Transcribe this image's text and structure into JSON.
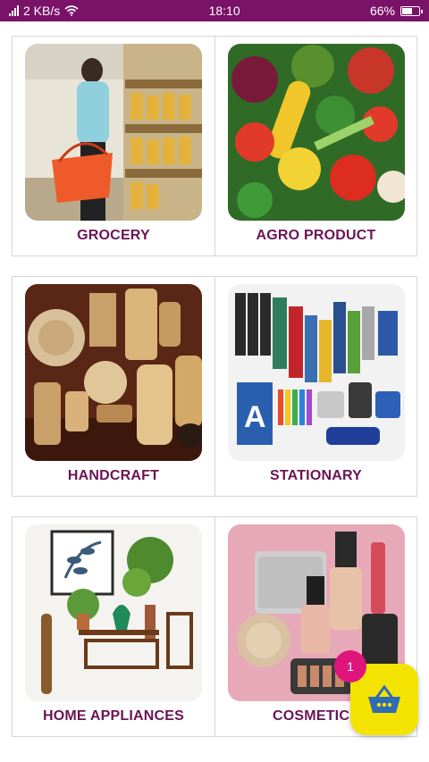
{
  "status_bar": {
    "network_speed": "2 KB/s",
    "time": "18:10",
    "battery_percent": "66%",
    "battery_level": 0.66
  },
  "categories": [
    {
      "label": "GROCERY"
    },
    {
      "label": "AGRO PRODUCT"
    },
    {
      "label": "HANDCRAFT"
    },
    {
      "label": "STATIONARY"
    },
    {
      "label": "HOME APPLIANCES"
    },
    {
      "label": "COSMETICS"
    }
  ],
  "cart": {
    "count": "1",
    "icon": "basket-icon",
    "accent": "#f4e300",
    "badge_color": "#e0157b"
  },
  "colors": {
    "status_bar": "#7a1268",
    "label": "#6a1457"
  }
}
